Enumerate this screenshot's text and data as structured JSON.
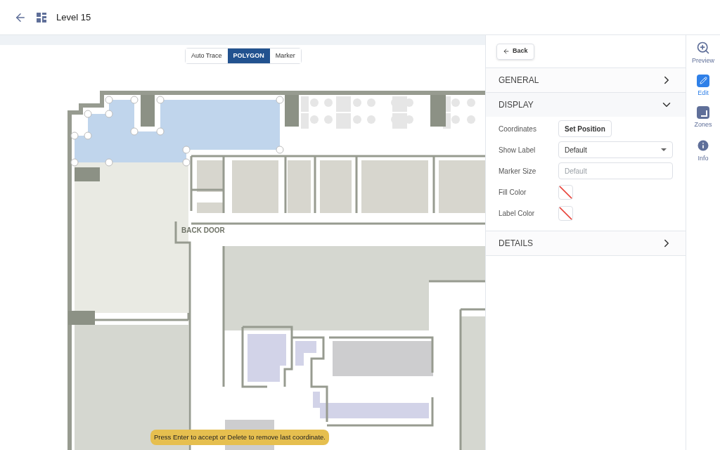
{
  "header": {
    "title": "Level 15"
  },
  "mode_toggle": [
    {
      "label": "Auto Trace",
      "selected": false
    },
    {
      "label": "POLYGON",
      "selected": true
    },
    {
      "label": "Marker",
      "selected": false
    }
  ],
  "map": {
    "room_label": "BACK DOOR"
  },
  "hint": "Press Enter to accept or Delete to remove last coordinate.",
  "panel": {
    "back": "Back",
    "sections": [
      {
        "title": "GENERAL",
        "expanded": false
      },
      {
        "title": "DISPLAY",
        "expanded": true,
        "fields": [
          {
            "kind": "button",
            "label": "Coordinates",
            "text": "Set Position"
          },
          {
            "kind": "select",
            "label": "Show Label",
            "value": "Default"
          },
          {
            "kind": "input",
            "label": "Marker Size",
            "placeholder": "Default"
          },
          {
            "kind": "color",
            "label": "Fill Color"
          },
          {
            "kind": "color",
            "label": "Label Color"
          }
        ]
      },
      {
        "title": "DETAILS",
        "expanded": false
      }
    ]
  },
  "rail": [
    {
      "kind": "preview",
      "label": "Preview",
      "selected": false
    },
    {
      "kind": "edit",
      "label": "Edit",
      "selected": true
    },
    {
      "kind": "zones",
      "label": "Zones",
      "selected": false
    },
    {
      "kind": "info",
      "label": "Info",
      "selected": false
    }
  ]
}
